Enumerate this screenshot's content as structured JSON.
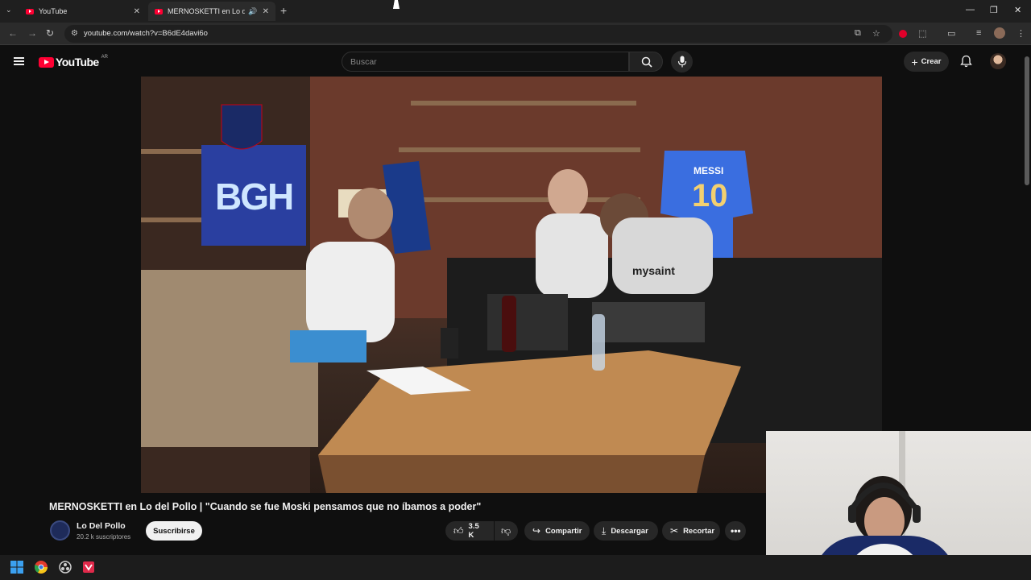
{
  "browser": {
    "tabs": [
      {
        "title": "YouTube"
      },
      {
        "title": "MERNOSKETTI en Lo del Pollo"
      }
    ],
    "url": "youtube.com/watch?v=B6dE4davi6o"
  },
  "youtube": {
    "country": "AR",
    "logo_text": "YouTube",
    "search_placeholder": "Buscar",
    "create_label": "Crear"
  },
  "video": {
    "title": "MERNOSKETTI en Lo del Pollo | \"Cuando se fue Moski pensamos que no íbamos a poder\"",
    "scene_texts": {
      "sign": "BGH",
      "jersey_name": "MESSI",
      "jersey_number": "10",
      "shirt": "mysaint"
    },
    "channel_name": "Lo Del Pollo",
    "subscribers": "20.2 k suscriptores",
    "subscribe_label": "Suscribirse",
    "likes": "3.5 K",
    "share_label": "Compartir",
    "download_label": "Descargar",
    "clip_label": "Recortar"
  },
  "colors": {
    "youtube_red": "#ff0033",
    "background": "#0f0f0f",
    "pill": "#272727"
  }
}
